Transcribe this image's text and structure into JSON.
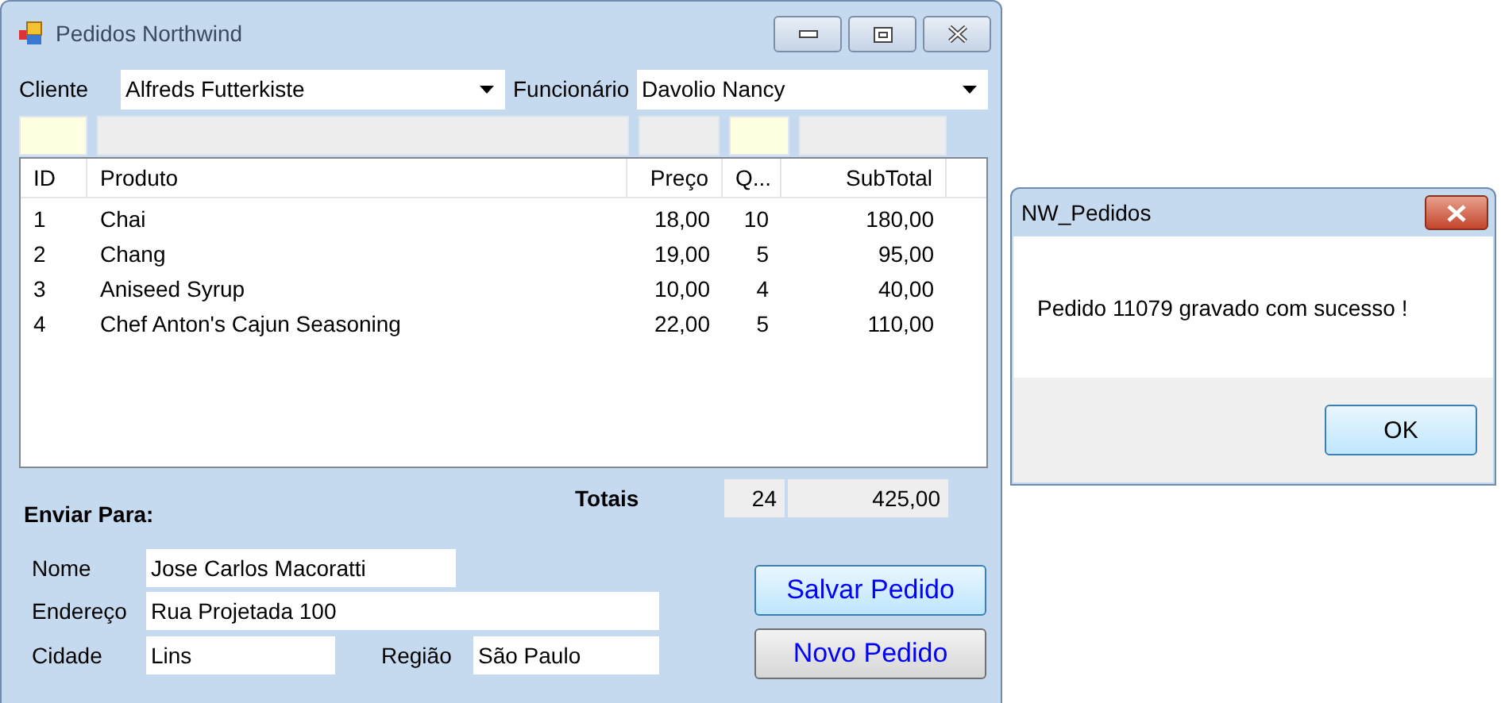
{
  "window": {
    "title": "Pedidos Northwind"
  },
  "cliente": {
    "label": "Cliente",
    "value": "Alfreds Futterkiste"
  },
  "funcionario": {
    "label": "Funcionário",
    "value": "Davolio Nancy"
  },
  "entry_fields": [
    {
      "color": "#ffffe1"
    },
    {
      "color": "#ededed"
    },
    {
      "color": "#ededed"
    },
    {
      "color": "#ffffe1"
    },
    {
      "color": "#ededed"
    }
  ],
  "table": {
    "columns": [
      "ID",
      "Produto",
      "Preço",
      "Q...",
      "SubTotal"
    ],
    "rows": [
      [
        "1",
        "Chai",
        "18,00",
        "10",
        "180,00"
      ],
      [
        "2",
        "Chang",
        "19,00",
        "5",
        "95,00"
      ],
      [
        "3",
        "Aniseed Syrup",
        "10,00",
        "4",
        "40,00"
      ],
      [
        "4",
        "Chef Anton's Cajun Seasoning",
        "22,00",
        "5",
        "110,00"
      ]
    ]
  },
  "totals": {
    "label": "Totais",
    "quantity": "24",
    "subtotal": "425,00"
  },
  "ship_to": {
    "heading": "Enviar Para:",
    "nome_label": "Nome",
    "nome": "Jose Carlos Macoratti",
    "endereco_label": "Endereço",
    "endereco": "Rua Projetada 100",
    "cidade_label": "Cidade",
    "cidade": "Lins",
    "regiao_label": "Região",
    "regiao": "São Paulo"
  },
  "buttons": [
    "Salvar Pedido",
    "Novo Pedido"
  ],
  "dialog": {
    "title": "NW_Pedidos",
    "message": "Pedido 11079 gravado com sucesso !",
    "button": "OK"
  }
}
